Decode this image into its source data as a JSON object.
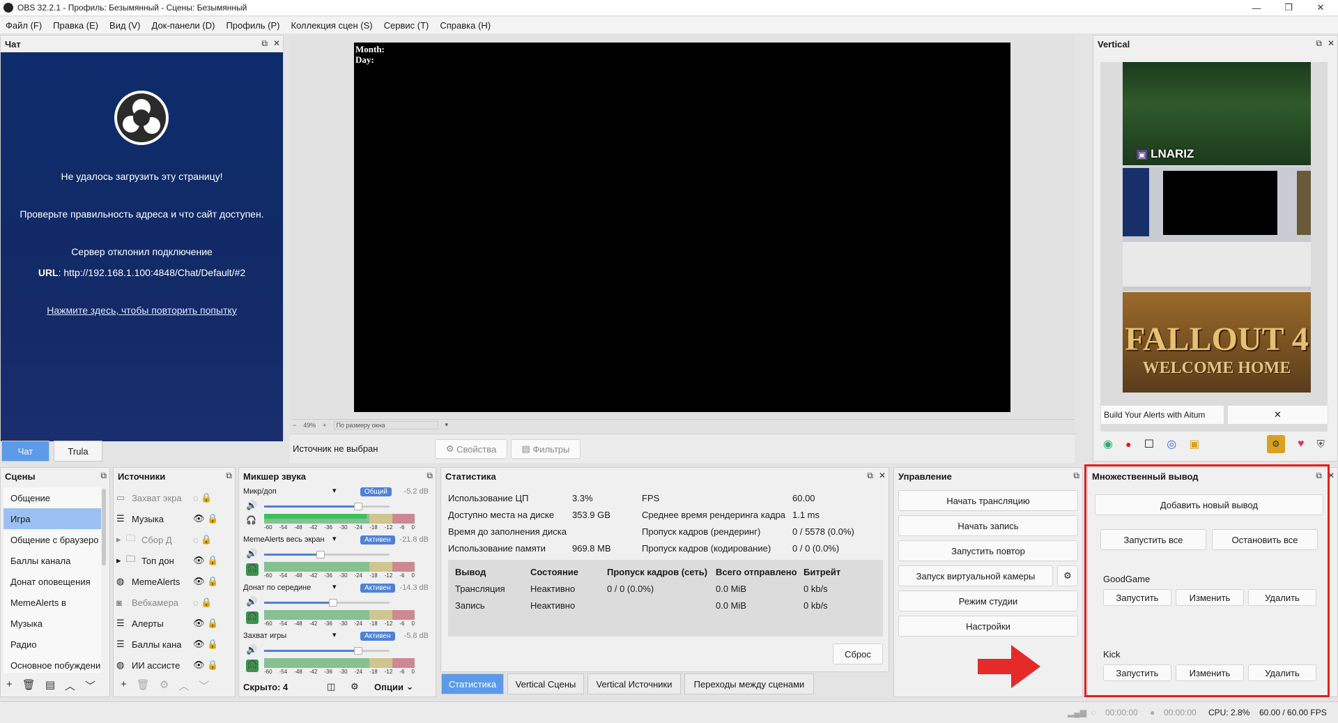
{
  "window": {
    "title": "OBS 32.2.1 - Профиль: Безымянный - Сцены: Безымянный",
    "controls": [
      "—",
      "❐",
      "✕"
    ]
  },
  "menu": [
    "Файл (F)",
    "Правка (E)",
    "Вид (V)",
    "Док-панели (D)",
    "Профиль (P)",
    "Коллекция сцен (S)",
    "Сервис (T)",
    "Справка (H)"
  ],
  "chat": {
    "title": "Чат",
    "error_title": "Не удалось загрузить эту страницу!",
    "error_hint": "Проверьте правильность адреса и что сайт доступен.",
    "error_reason": "Сервер отклонил подключение",
    "url_label": "URL",
    "url_value": ": http://192.168.1.100:4848/Chat/Default/#2",
    "retry": "Нажмите здесь, чтобы повторить попытку",
    "tabs": [
      "Чат",
      "Trula"
    ]
  },
  "preview": {
    "overlay_line1": "Month:",
    "overlay_line2": "Day:",
    "zoom": "49%",
    "zoom_mode": "По размеру окна",
    "no_source": "Источник не выбран",
    "properties": "Свойства",
    "filters": "Фильтры"
  },
  "vertical": {
    "title": "Vertical",
    "logo_text": "LNARIZ",
    "game_title": "FALLOUT 4",
    "game_sub": "WELCOME HOME",
    "aitum_label": "Build Your Alerts with Aitum",
    "close": "✕"
  },
  "scenes": {
    "title": "Сцены",
    "items": [
      "Общение",
      "Игра",
      "Общение с браузеро",
      "Баллы канала",
      "Донат оповещения",
      "MemeAlerts в",
      "Музыка",
      "Радио",
      "Основное побуждение"
    ],
    "selected_index": 1
  },
  "sources": {
    "title": "Источники",
    "items": [
      "Захват экра",
      "Музыка",
      "Сбор Д",
      "Топ дон",
      "MemeAlerts",
      "Вебкамера",
      "Алерты",
      "Баллы кана",
      "ИИ ассисте"
    ]
  },
  "mixer": {
    "title": "Микшер звука",
    "channels": [
      {
        "name": "Микр/доп",
        "badge": "Общий",
        "db": "-5.2 dB",
        "volume": 0.75,
        "level": 0.68
      },
      {
        "name": "MemeAlerts весь экран",
        "badge": "Активен",
        "db": "-21.8 dB",
        "volume": 0.45,
        "level": 0.0
      },
      {
        "name": "Донат по середине",
        "badge": "Активен",
        "db": "-14.3 dB",
        "volume": 0.55,
        "level": 0.0
      },
      {
        "name": "Захват игры",
        "badge": "Активен",
        "db": "-5.8 dB",
        "volume": 0.75,
        "level": 0.0
      }
    ],
    "scale": [
      "-60",
      "-54",
      "-48",
      "-42",
      "-36",
      "-30",
      "-24",
      "-18",
      "-12",
      "-6",
      "0"
    ],
    "hidden": "Скрыто: 4",
    "options": "Опции"
  },
  "stats": {
    "title": "Статистика",
    "left": [
      {
        "label": "Использование ЦП",
        "value": "3.3%"
      },
      {
        "label": "Доступно места на диске",
        "value": "353.9 GB"
      },
      {
        "label": "Время до заполнения диска",
        "value": ""
      },
      {
        "label": "Использование памяти",
        "value": "969.8 MB"
      }
    ],
    "right": [
      {
        "label": "FPS",
        "value": "60.00"
      },
      {
        "label": "Среднее время рендеринга кадра",
        "value": "1.1 ms"
      },
      {
        "label": "Пропуск кадров (рендеринг)",
        "value": "0 / 5578 (0.0%)"
      },
      {
        "label": "Пропуск кадров (кодирование)",
        "value": "0 / 0 (0.0%)"
      }
    ],
    "table_headers": [
      "Вывод",
      "Состояние",
      "Пропуск кадров (сеть)",
      "Всего отправлено",
      "Битрейт"
    ],
    "table_rows": [
      [
        "Трансляция",
        "Неактивно",
        "0 / 0 (0.0%)",
        "0.0 MiB",
        "0 kb/s"
      ],
      [
        "Запись",
        "Неактивно",
        "",
        "0.0 MiB",
        "0 kb/s"
      ]
    ],
    "reset": "Сброс"
  },
  "bottom_tabs": [
    "Статистика",
    "Vertical Сцены",
    "Vertical Источники",
    "Переходы между сценами"
  ],
  "controls": {
    "title": "Управление",
    "buttons": [
      "Начать трансляцию",
      "Начать запись",
      "Запустить повтор",
      "Запуск виртуальной камеры",
      "Режим студии",
      "Настройки"
    ]
  },
  "multi_output": {
    "title": "Множественный вывод",
    "add": "Добавить новый вывод",
    "start_all": "Запустить все",
    "stop_all": "Остановить все",
    "outputs": [
      {
        "name": "GoodGame",
        "start": "Запустить",
        "edit": "Изменить",
        "delete": "Удалить"
      },
      {
        "name": "Kick",
        "start": "Запустить",
        "edit": "Изменить",
        "delete": "Удалить"
      }
    ]
  },
  "statusbar": {
    "stream_time": "00:00:00",
    "rec_time": "00:00:00",
    "cpu": "CPU: 2.8%",
    "fps": "60.00 / 60.00 FPS"
  },
  "colors": {
    "accent": "#5b9bea",
    "highlight_box": "#e02020",
    "arrow": "#e52a2a",
    "chat_bg": "#0f2c6a"
  }
}
